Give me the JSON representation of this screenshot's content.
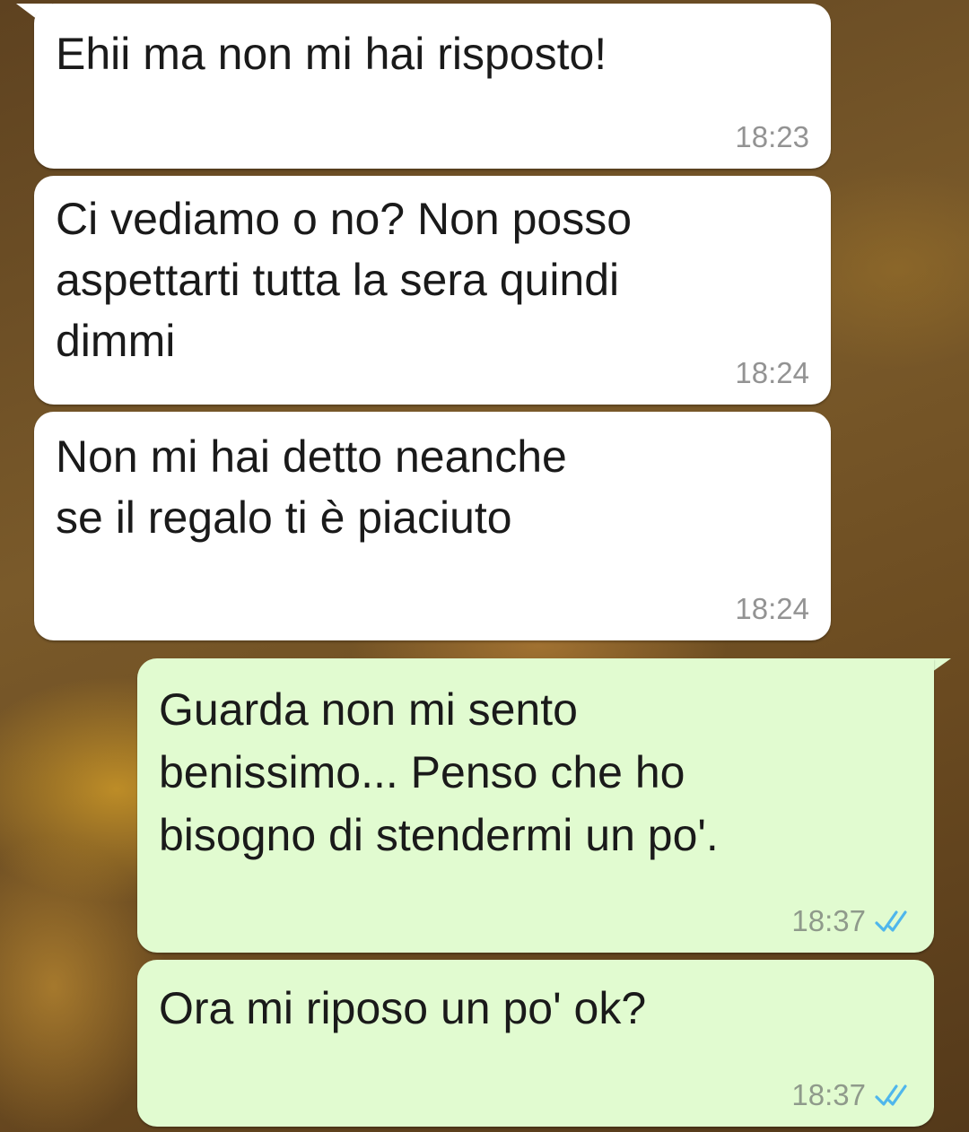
{
  "messages": [
    {
      "direction": "incoming",
      "text": "Ehii ma non mi hai risposto!",
      "time": "18:23"
    },
    {
      "direction": "incoming",
      "text": "Ci vediamo o no? Non posso\naspettarti tutta la sera quindi\ndimmi",
      "time": "18:24"
    },
    {
      "direction": "incoming",
      "text": "Non mi hai detto neanche\nse il regalo ti è piaciuto",
      "time": "18:24"
    },
    {
      "direction": "outgoing",
      "text": "Guarda non mi sento\nbenissimo... Penso che ho\nbisogno di stendermi un po'.",
      "time": "18:37",
      "status_icon": "double-check-read-icon"
    },
    {
      "direction": "outgoing",
      "text": "Ora mi riposo un po' ok?",
      "time": "18:37",
      "status_icon": "double-check-read-icon"
    }
  ],
  "colors": {
    "incoming_bubble": "#ffffff",
    "outgoing_bubble": "#e1fbd0",
    "read_tick": "#4fb6ec",
    "text": "#1a1a1a",
    "time": "#939393"
  }
}
